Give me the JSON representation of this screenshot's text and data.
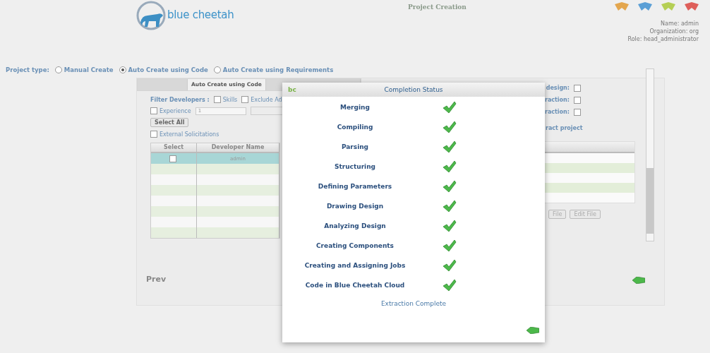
{
  "header": {
    "logo_text": "blue cheetah",
    "page_title": "Project Creation",
    "nav_icons": [
      {
        "color": "#e3a64e"
      },
      {
        "color": "#5a9fd6"
      },
      {
        "color": "#b5cf55"
      },
      {
        "color": "#de5f5a"
      }
    ],
    "user": [
      "Name: admin",
      "Organization: org",
      "Role: head_administrator"
    ]
  },
  "project_type": {
    "label": "Project type:",
    "options": [
      {
        "label": "Manual Create",
        "selected": false
      },
      {
        "label": "Auto Create using Code",
        "selected": true
      },
      {
        "label": "Auto Create using Requirements",
        "selected": false
      }
    ]
  },
  "tabs": [
    {
      "selected": false
    },
    {
      "label": "Auto Create using Code",
      "selected": true
    },
    {
      "selected": false
    }
  ],
  "filter": {
    "label": "Filter Developers :",
    "options": [
      {
        "label": "Skills",
        "checked": false
      },
      {
        "label": "Exclude Ad",
        "checked": false
      }
    ],
    "experience": {
      "label": "Experience",
      "checked": false,
      "value": "1"
    },
    "select_all": "Select All",
    "external": {
      "label": "External Solicitations",
      "checked": false
    }
  },
  "developers": {
    "columns": [
      "Select",
      "Developer Name"
    ],
    "rows": [
      {
        "selected": true,
        "checked": false,
        "name": "admin"
      },
      {
        "selected": false
      },
      {
        "selected": false
      },
      {
        "selected": false
      },
      {
        "selected": false
      },
      {
        "selected": false
      },
      {
        "selected": false
      },
      {
        "selected": false
      }
    ]
  },
  "right_panel": {
    "options": [
      {
        "label": "design:",
        "checked": false
      },
      {
        "label": "raction:",
        "checked": false
      },
      {
        "label": "raction:",
        "checked": false
      }
    ],
    "section_label": "ract project",
    "rows": [
      {},
      {},
      {},
      {},
      {}
    ],
    "buttons": [
      "File",
      "Edit File"
    ]
  },
  "prev": "Prev",
  "modal": {
    "logo": "bc",
    "title": "Completion Status",
    "steps": [
      {
        "label": "Merging",
        "done": true
      },
      {
        "label": "Compiling",
        "done": true
      },
      {
        "label": "Parsing",
        "done": true
      },
      {
        "label": "Structuring",
        "done": true
      },
      {
        "label": "Defining Parameters",
        "done": true
      },
      {
        "label": "Drawing Design",
        "done": true
      },
      {
        "label": "Analyzing Design",
        "done": true
      },
      {
        "label": "Creating Components",
        "done": true
      },
      {
        "label": "Creating and Assigning Jobs",
        "done": true
      },
      {
        "label": "Code in Blue Cheetah Cloud",
        "done": true
      }
    ],
    "footer": "Extraction Complete"
  }
}
